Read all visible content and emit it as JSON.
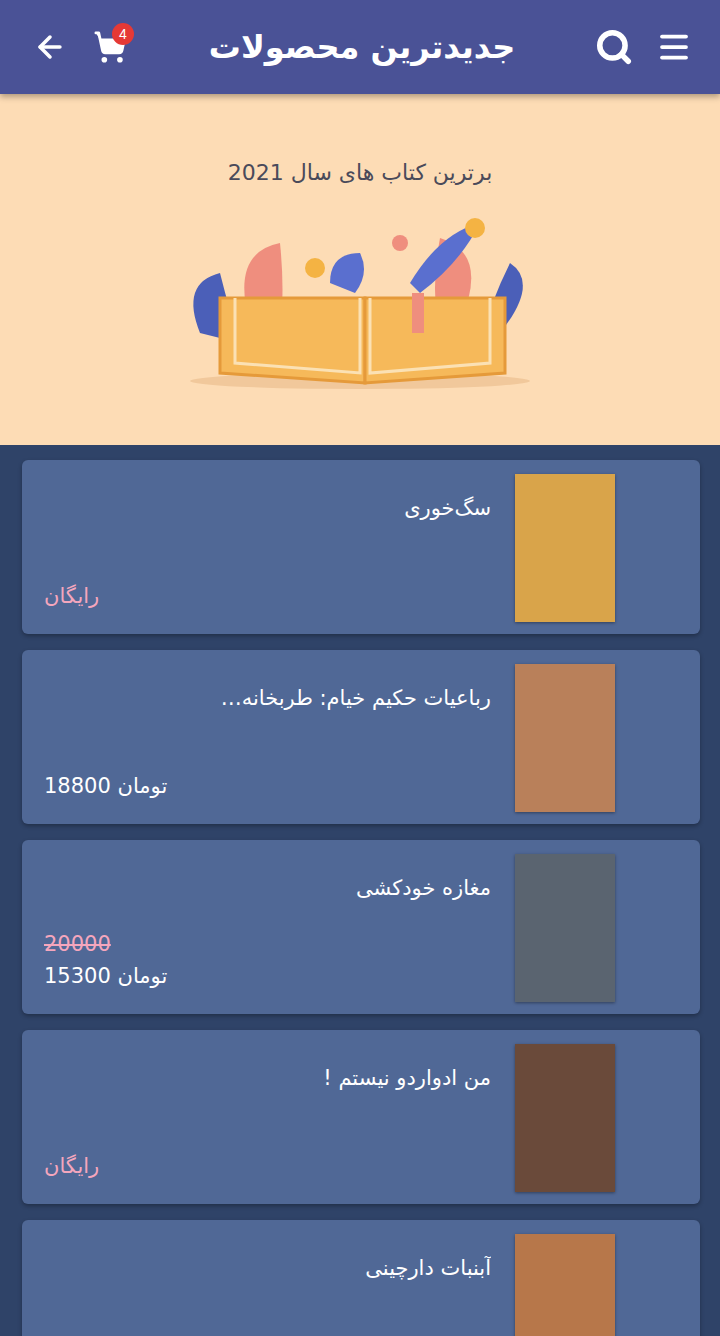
{
  "header": {
    "title": "جدیدترین محصولات",
    "cart_count": "4"
  },
  "banner": {
    "title": "برترین کتاب های سال 2021"
  },
  "products": [
    {
      "title": "سگ‌خوری",
      "kind": "free",
      "price": "رایگان",
      "color": "#d9a44a"
    },
    {
      "title": "رباعیات حکیم خیام: طربخانه…",
      "kind": "paid",
      "price": "18800 تومان",
      "color": "#b9805a"
    },
    {
      "title": "مغازه خودکشی",
      "kind": "discount",
      "old_price": "20000",
      "price": "15300 تومان",
      "color": "#5a6470"
    },
    {
      "title": "من ادواردو نیستم !",
      "kind": "free",
      "price": "رایگان",
      "color": "#6a4a3a"
    },
    {
      "title": "آبنبات دارچینی",
      "kind": "unpriced",
      "color": "#b7774a"
    }
  ]
}
